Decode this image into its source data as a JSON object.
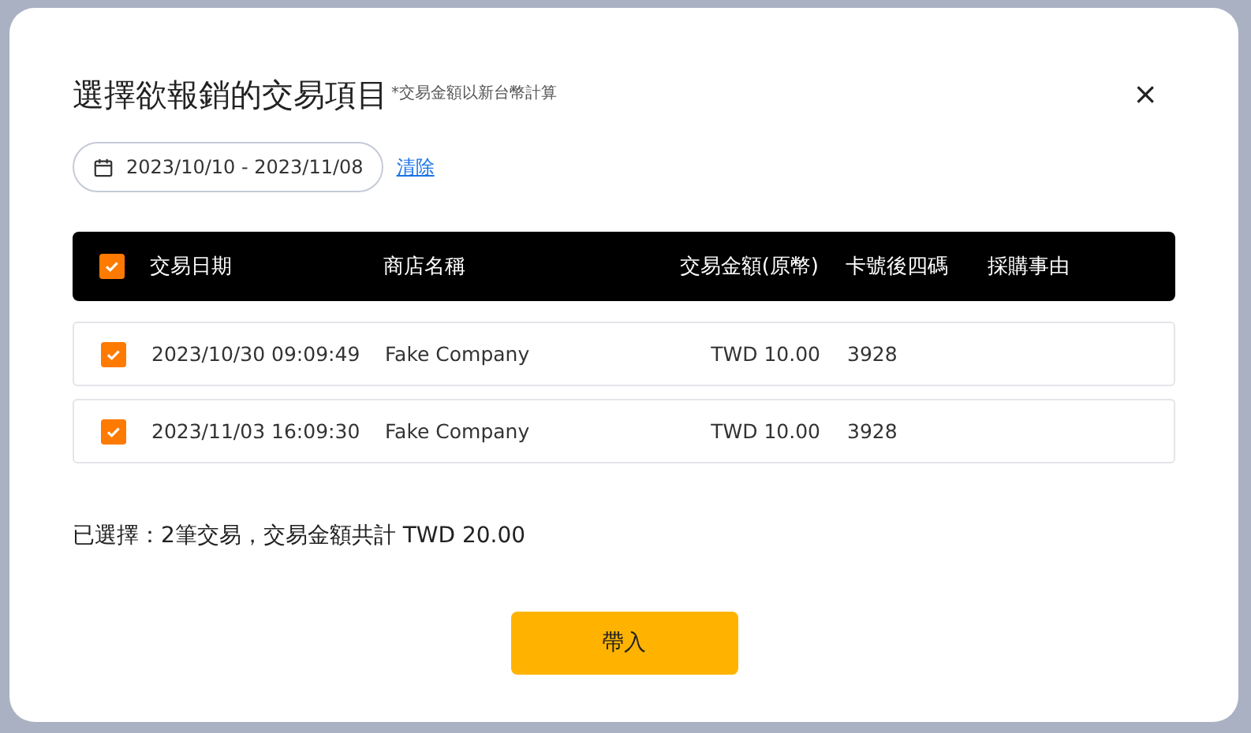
{
  "dialog": {
    "title": "選擇欲報銷的交易項目",
    "note": "*交易金額以新台幣計算",
    "close": "×"
  },
  "date_range": {
    "value": "2023/10/10 - 2023/11/08",
    "clear": "清除"
  },
  "table": {
    "select_all": true,
    "columns": [
      "交易日期",
      "商店名稱",
      "交易金額(原幣)",
      "卡號後四碼",
      "採購事由"
    ],
    "rows": [
      {
        "selected": true,
        "cells": [
          "2023/10/30 09:09:49",
          "Fake Company",
          "TWD 10.00",
          "3928"
        ]
      },
      {
        "selected": true,
        "cells": [
          "2023/11/03 16:09:30",
          "Fake Company",
          "TWD 10.00",
          "3928"
        ]
      }
    ]
  },
  "summary": "已選擇：2筆交易，交易金額共計 TWD 20.00",
  "submit": "帶入"
}
